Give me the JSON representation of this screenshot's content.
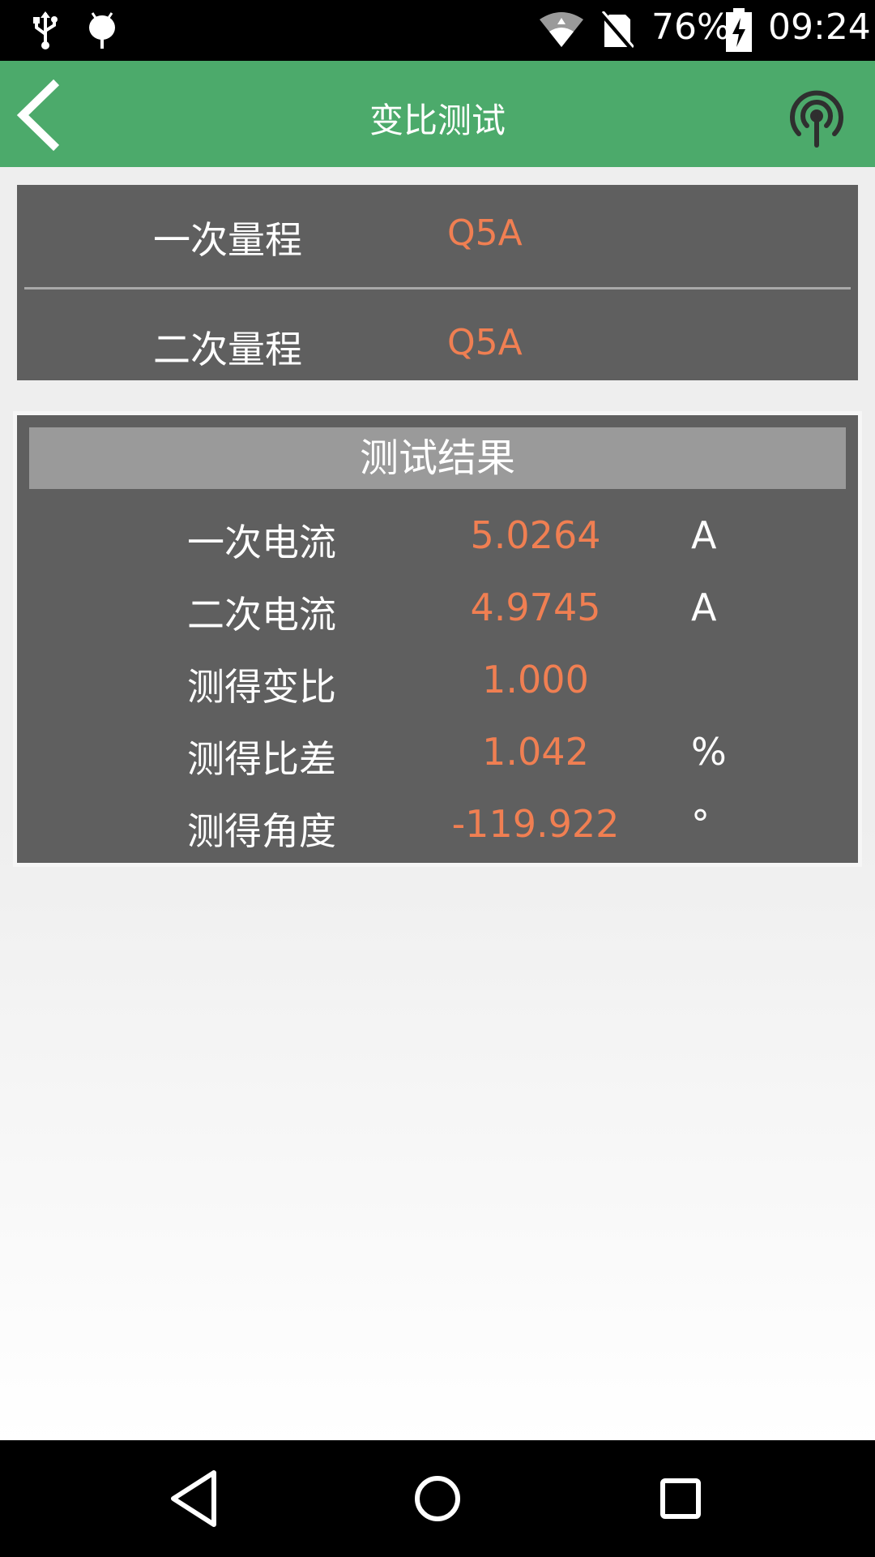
{
  "status_bar": {
    "battery_percent": "76%",
    "time": "09:24",
    "icons": [
      "usb-icon",
      "android-debug-icon",
      "wifi-icon",
      "no-sim-icon",
      "battery-charging-icon"
    ]
  },
  "app_bar": {
    "title": "变比测试",
    "back_icon": "chevron-left-icon",
    "action_icon": "wireless-signal-icon"
  },
  "range": {
    "primary": {
      "label": "一次量程",
      "value": "Q5A"
    },
    "secondary": {
      "label": "二次量程",
      "value": "Q5A"
    }
  },
  "results": {
    "header": "测试结果",
    "rows": [
      {
        "label": "一次电流",
        "value": "5.0264",
        "unit": "A"
      },
      {
        "label": "二次电流",
        "value": "4.9745",
        "unit": "A"
      },
      {
        "label": "测得变比",
        "value": "1.000",
        "unit": ""
      },
      {
        "label": "测得比差",
        "value": "1.042",
        "unit": "%"
      },
      {
        "label": "测得角度",
        "value": "-119.922",
        "unit": "°"
      }
    ]
  },
  "nav_bar": {
    "icons": [
      "back-triangle-icon",
      "home-circle-icon",
      "recents-square-icon"
    ]
  },
  "colors": {
    "app_bar": "#4caa6b",
    "panel": "#5f5f5f",
    "header_strip": "#9a9a9a",
    "value_accent": "#f07f52"
  }
}
